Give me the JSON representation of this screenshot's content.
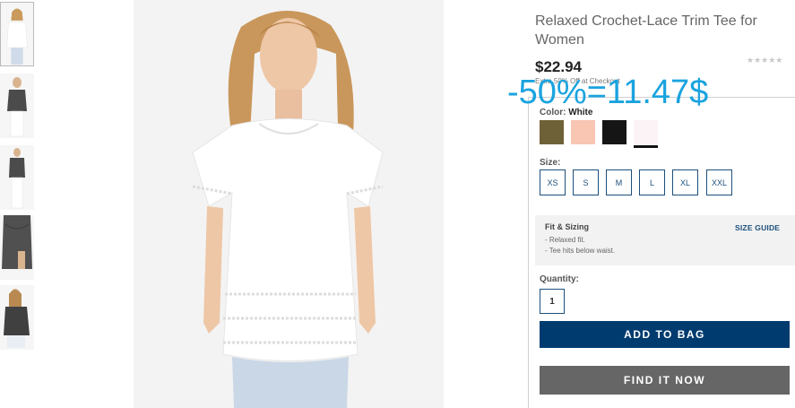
{
  "product": {
    "title": "Relaxed Crochet-Lace Trim Tee for Women",
    "price": "$22.94",
    "promo": "Extra 50% Off at Checkout",
    "rating_stars": "★★★★★",
    "discount_overlay": "-50%=11.47$"
  },
  "thumbnails": [
    {
      "name": "front white tee",
      "selected": true
    },
    {
      "name": "grey tee front",
      "selected": false
    },
    {
      "name": "grey tee full",
      "selected": false
    },
    {
      "name": "grey tee detail",
      "selected": false
    },
    {
      "name": "grey tee seated",
      "selected": false
    }
  ],
  "color": {
    "label": "Color:",
    "selected": "White",
    "swatches": [
      {
        "name": "olive",
        "hex": "#6e6137",
        "active": false
      },
      {
        "name": "peach",
        "hex": "#f8c6b3",
        "active": false
      },
      {
        "name": "black",
        "hex": "#151515",
        "active": false
      },
      {
        "name": "white",
        "hex": "#fbf3f5",
        "active": true
      }
    ]
  },
  "size": {
    "label": "Size:",
    "options": [
      "XS",
      "S",
      "M",
      "L",
      "XL",
      "XXL"
    ]
  },
  "fit": {
    "title": "Fit & Sizing",
    "lines": [
      "- Relaxed fit.",
      "- Tee hits below waist."
    ],
    "guide_label": "SIZE GUIDE"
  },
  "quantity": {
    "label": "Quantity:",
    "value": "1"
  },
  "actions": {
    "add_to_bag": "ADD TO BAG",
    "find_it_now": "FIND IT NOW"
  },
  "colors": {
    "primary_blue": "#003b6f",
    "accent_blue": "#1c4f7c",
    "overlay_blue": "#1aa3df",
    "find_grey": "#666666"
  }
}
